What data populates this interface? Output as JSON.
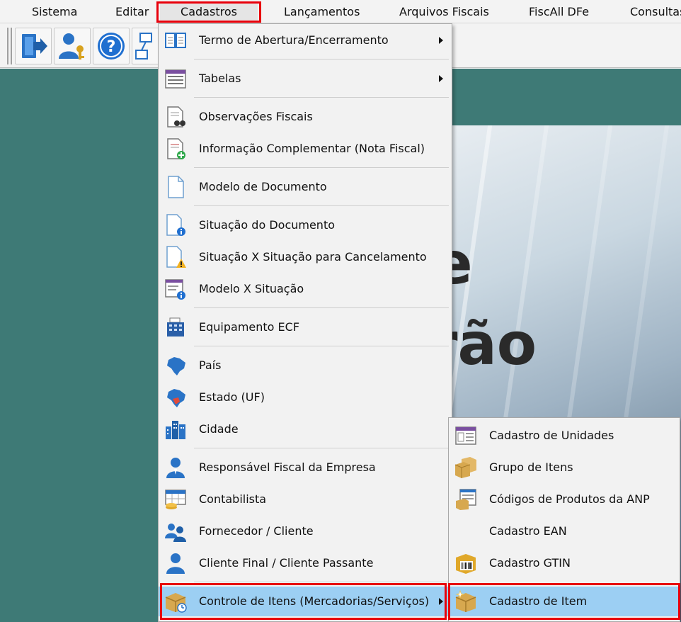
{
  "menubar": {
    "items": [
      {
        "label": "Sistema",
        "icon": ""
      },
      {
        "label": "Editar"
      },
      {
        "label": "Cadastros"
      },
      {
        "label": "Lançamentos"
      },
      {
        "label": "Arquivos Fiscais"
      },
      {
        "label": "FiscAll DFe"
      },
      {
        "label": "Consultas"
      }
    ]
  },
  "toolbar": {
    "buttons": [
      {
        "icon": "exit-door-icon"
      },
      {
        "icon": "user-key-icon"
      },
      {
        "icon": "help-icon"
      },
      {
        "icon": "network-icon"
      }
    ]
  },
  "banner": {
    "text_line1": "e",
    "text_line2": "rão"
  },
  "cadastros_menu": {
    "items": [
      {
        "label": "Termo de Abertura/Encerramento",
        "icon": "book-icon",
        "submenu": true
      },
      {
        "label": "Tabelas",
        "icon": "table-list-icon",
        "submenu": true
      },
      {
        "label": "Observações Fiscais",
        "icon": "document-binoculars-icon"
      },
      {
        "label": "Informação Complementar (Nota Fiscal)",
        "icon": "document-add-icon"
      },
      {
        "label": "Modelo de Documento",
        "icon": "blank-document-icon"
      },
      {
        "label": "Situação do Documento",
        "icon": "document-info-icon"
      },
      {
        "label": "Situação X Situação para Cancelamento",
        "icon": "document-warning-icon"
      },
      {
        "label": "Modelo X Situação",
        "icon": "form-info-icon"
      },
      {
        "label": "Equipamento ECF",
        "icon": "cash-register-icon"
      },
      {
        "label": "País",
        "icon": "brazil-map-icon"
      },
      {
        "label": "Estado (UF)",
        "icon": "brazil-state-map-icon"
      },
      {
        "label": "Cidade",
        "icon": "city-buildings-icon"
      },
      {
        "label": "Responsável Fiscal da Empresa",
        "icon": "person-icon"
      },
      {
        "label": "Contabilista",
        "icon": "calculator-coins-icon"
      },
      {
        "label": "Fornecedor / Cliente",
        "icon": "people-icon"
      },
      {
        "label": "Cliente Final / Cliente Passante",
        "icon": "person-icon"
      },
      {
        "label": "Controle de Itens (Mercadorias/Serviços)",
        "icon": "box-clock-icon",
        "submenu": true
      }
    ]
  },
  "itens_submenu": {
    "items": [
      {
        "label": "Cadastro de Unidades",
        "icon": "window-grid-icon"
      },
      {
        "label": "Grupo de Itens",
        "icon": "boxes-icon"
      },
      {
        "label": "Códigos de Produtos da ANP",
        "icon": "fuel-table-icon"
      },
      {
        "label": "Cadastro EAN",
        "icon": ""
      },
      {
        "label": "Cadastro GTIN",
        "icon": "barcode-box-icon"
      },
      {
        "label": "Cadastro de Item",
        "icon": "box-sparkle-icon"
      }
    ]
  },
  "colors": {
    "workspace": "#3e7a76",
    "highlight": "#9ccff3",
    "annotation": "#e8000b"
  }
}
